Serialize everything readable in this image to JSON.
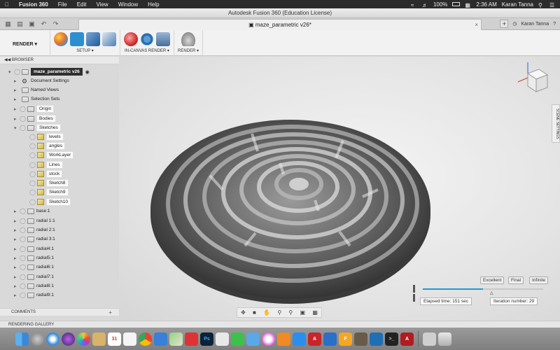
{
  "menubar": {
    "apple_icon": "apple-icon",
    "items": [
      "Fusion 360",
      "File",
      "Edit",
      "View",
      "Window",
      "Help"
    ],
    "battery": "100%",
    "time": "2:36 AM",
    "user": "Karan Tanna"
  },
  "window": {
    "title": "Autodesk Fusion 360 (Education License)"
  },
  "tabbar": {
    "doc_tab": "maze_parametric v26*",
    "user": "Karan Tanna"
  },
  "toolbar": {
    "workspace": "RENDER ▾",
    "groups": [
      {
        "label": "SETUP ▾"
      },
      {
        "label": "IN-CANVAS RENDER ▾"
      },
      {
        "label": "RENDER ▾"
      }
    ]
  },
  "browser": {
    "header": "BROWSER",
    "root": "maze_parametric v26",
    "items": [
      "Document Settings",
      "Named Views",
      "Selection Sets",
      "Origin",
      "Bodies",
      "Sketches"
    ],
    "sketches": [
      "levels",
      "angles",
      "WorkLayer",
      "Lines",
      "stock",
      "Sketch8",
      "Sketch9",
      "Sketch10"
    ],
    "components": [
      "base:1",
      "radial 1:1",
      "radial 2:1",
      "radial 3:1",
      "radial4:1",
      "radial5:1",
      "radial6:1",
      "radial7:1",
      "radial8:1",
      "radial9:1"
    ]
  },
  "comments": {
    "label": "COMMENTS"
  },
  "gallery": {
    "label": "RENDERING GALLERY"
  },
  "viewport": {
    "scene_settings": "SCENE SETTINGS"
  },
  "render": {
    "quality_buttons": [
      "Excellent",
      "Final",
      "Infinite"
    ],
    "progress": 0.5,
    "elapsed": "Elapsed time: 151 sec",
    "iteration": "Iteration number: 29"
  },
  "colors": {
    "accent": "#1e9ad6",
    "menubar": "#2b2b2b"
  },
  "dock": {
    "apps": [
      "finder",
      "launchpad",
      "safari",
      "siri",
      "photos",
      "notes",
      "calendar",
      "reminders",
      "chrome",
      "maps",
      "messages",
      "photoshop",
      "fusion",
      "facetime",
      "books",
      "appstore",
      "itunes",
      "xcode",
      "terminal",
      "acrobat",
      "trash"
    ]
  }
}
